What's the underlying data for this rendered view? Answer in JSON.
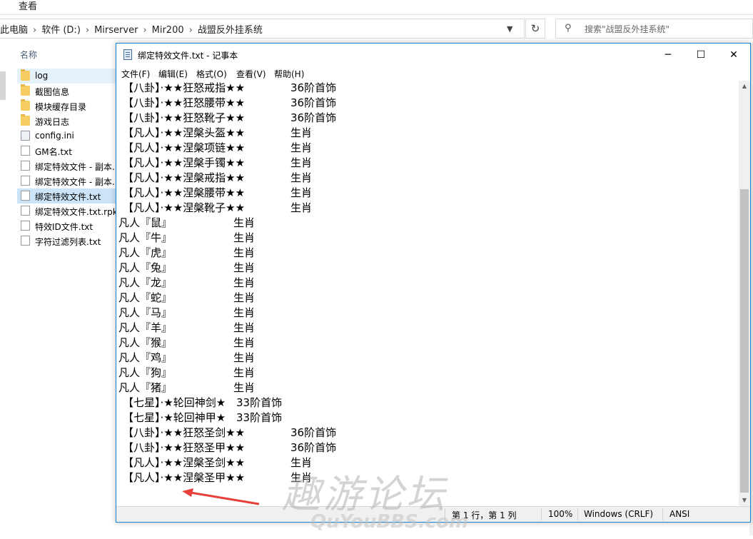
{
  "explorer": {
    "ribbon_tab": "查看",
    "breadcrumb": [
      "此电脑",
      "软件 (D:)",
      "Mirserver",
      "Mir200",
      "战盟反外挂系统"
    ],
    "search_placeholder": "搜索\"战盟反外挂系统\"",
    "column_header": "名称",
    "files": [
      {
        "name": "log",
        "icon": "folder-icon"
      },
      {
        "name": "截图信息",
        "icon": "folder-icon"
      },
      {
        "name": "模块缓存目录",
        "icon": "folder-icon"
      },
      {
        "name": "游戏日志",
        "icon": "folder-icon"
      },
      {
        "name": "config.ini",
        "icon": "settings-file-icon"
      },
      {
        "name": "GM名.txt",
        "icon": "text-file-icon"
      },
      {
        "name": "绑定特效文件 - 副本.",
        "icon": "text-file-icon"
      },
      {
        "name": "绑定特效文件 - 副本.",
        "icon": "text-file-icon"
      },
      {
        "name": "绑定特效文件.txt",
        "icon": "text-file-icon",
        "selected": true
      },
      {
        "name": "绑定特效文件.txt.rpk",
        "icon": "file-icon"
      },
      {
        "name": "特效ID文件.txt",
        "icon": "text-file-icon"
      },
      {
        "name": "字符过滤列表.txt",
        "icon": "text-file-icon"
      }
    ]
  },
  "notepad": {
    "title": "绑定特效文件.txt - 记事本",
    "window_controls": {
      "minimize": "─",
      "maximize": "☐",
      "close": "✕"
    },
    "menu": [
      "文件(F)",
      "编辑(E)",
      "格式(O)",
      "查看(V)",
      "帮助(H)"
    ],
    "lines": [
      [
        "【八卦】·★★狂怒戒指★★",
        "36阶首饰"
      ],
      [
        "【八卦】·★★狂怒腰带★★",
        "36阶首饰"
      ],
      [
        "【八卦】·★★狂怒靴子★★",
        "36阶首饰"
      ],
      [
        "【凡人】·★★涅槃头盔★★",
        "生肖"
      ],
      [
        "【凡人】·★★涅槃项链★★",
        "生肖"
      ],
      [
        "【凡人】·★★涅槃手镯★★",
        "生肖"
      ],
      [
        "【凡人】·★★涅槃戒指★★",
        "生肖"
      ],
      [
        "【凡人】·★★涅槃腰带★★",
        "生肖"
      ],
      [
        "【凡人】·★★涅槃靴子★★",
        "生肖"
      ],
      [
        "凡人『鼠』",
        "生肖"
      ],
      [
        "凡人『牛』",
        "生肖"
      ],
      [
        "凡人『虎』",
        "生肖"
      ],
      [
        "凡人『兔』",
        "生肖"
      ],
      [
        "凡人『龙』",
        "生肖"
      ],
      [
        "凡人『蛇』",
        "生肖"
      ],
      [
        "凡人『马』",
        "生肖"
      ],
      [
        "凡人『羊』",
        "生肖"
      ],
      [
        "凡人『猴』",
        "生肖"
      ],
      [
        "凡人『鸡』",
        "生肖"
      ],
      [
        "凡人『狗』",
        "生肖"
      ],
      [
        "凡人『猪』",
        "生肖"
      ],
      [
        "【七星】·★轮回神剑★",
        "33阶首饰"
      ],
      [
        "【七星】·★轮回神甲★",
        "33阶首饰"
      ],
      [
        "【八卦】·★★狂怒圣剑★★",
        "36阶首饰"
      ],
      [
        "【八卦】·★★狂怒圣甲★★",
        "36阶首饰"
      ],
      [
        "【凡人】·★★涅槃圣剑★★",
        "生肖"
      ],
      [
        "【凡人】·★★涅槃圣甲★★",
        "生肖"
      ]
    ],
    "status": {
      "position": "第 1 行，第 1 列",
      "zoom": "100%",
      "line_ending": "Windows (CRLF)",
      "encoding": "ANSI"
    }
  },
  "watermark": {
    "text": "趣游论坛",
    "subtext": "QuYouBBS.com"
  },
  "colors": {
    "accent": "#1883d7",
    "selection": "#cce4f7",
    "arrow": "#e8413c"
  }
}
